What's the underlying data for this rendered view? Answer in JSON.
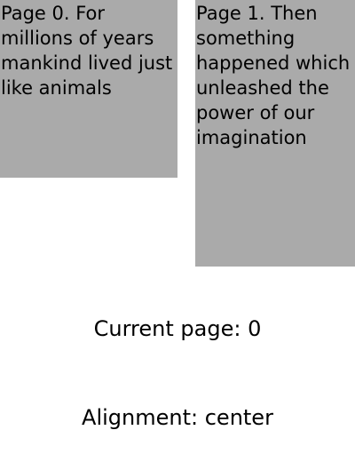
{
  "pages": [
    {
      "text": "Page 0. For millions of years mankind lived just like animals"
    },
    {
      "text": "Page 1. Then something happened which unleashed the power of our imagination"
    }
  ],
  "status": {
    "current_page_text": "Current page: 0",
    "alignment_text": "Alignment: center"
  },
  "colors": {
    "page_background": "#aaaaaa",
    "background": "#ffffff",
    "text": "#000000"
  }
}
